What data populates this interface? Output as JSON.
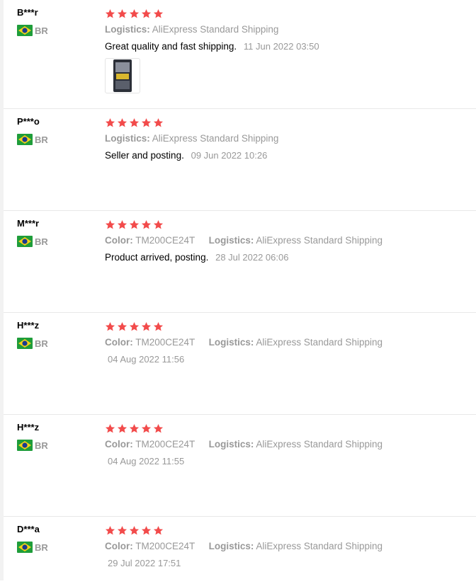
{
  "labels": {
    "logistics": "Logistics:",
    "color": "Color:"
  },
  "colors": {
    "star": "#f24b4b",
    "muted": "#999999",
    "divider": "#e8e8e8"
  },
  "reviews": [
    {
      "user": "B***r",
      "country": "BR",
      "rating": 5,
      "logistics": "AliExpress Standard Shipping",
      "feedback": "Great quality and fast shipping.",
      "date": "11 Jun 2022 03:50",
      "has_photo": true
    },
    {
      "user": "P***o",
      "country": "BR",
      "rating": 5,
      "logistics": "AliExpress Standard Shipping",
      "feedback": "Seller and posting.",
      "date": "09 Jun 2022 10:26"
    },
    {
      "user": "M***r",
      "country": "BR",
      "rating": 5,
      "color": "TM200CE24T",
      "logistics": "AliExpress Standard Shipping",
      "feedback": "Product arrived, posting.",
      "date": "28 Jul 2022 06:06"
    },
    {
      "user": "H***z",
      "country": "BR",
      "rating": 5,
      "color": "TM200CE24T",
      "logistics": "AliExpress Standard Shipping",
      "feedback": "",
      "date": "04 Aug 2022 11:56"
    },
    {
      "user": "H***z",
      "country": "BR",
      "rating": 5,
      "color": "TM200CE24T",
      "logistics": "AliExpress Standard Shipping",
      "feedback": "",
      "date": "04 Aug 2022 11:55"
    },
    {
      "user": "D***a",
      "country": "BR",
      "rating": 5,
      "color": "TM200CE24T",
      "logistics": "AliExpress Standard Shipping",
      "feedback": "",
      "date": "29 Jul 2022 17:51"
    }
  ]
}
